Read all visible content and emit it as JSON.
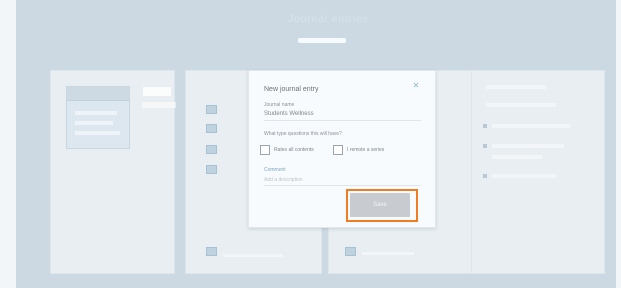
{
  "hero": {
    "title": "Journal entries"
  },
  "modal": {
    "title": "New journal entry",
    "close_icon": "close-icon",
    "field_label": "Journal name",
    "field_value": "Students Wellness",
    "question": "What type questions this will have?",
    "checkbox_one": "Rates all contents",
    "checkbox_two": "I remote a series",
    "section_label": "Comment",
    "section_placeholder": "Add a description",
    "action_button": "Save"
  },
  "colors": {
    "background": "#ccd9e2",
    "highlight": "#ee7d24",
    "disabled_button": "#c8ccd0"
  }
}
